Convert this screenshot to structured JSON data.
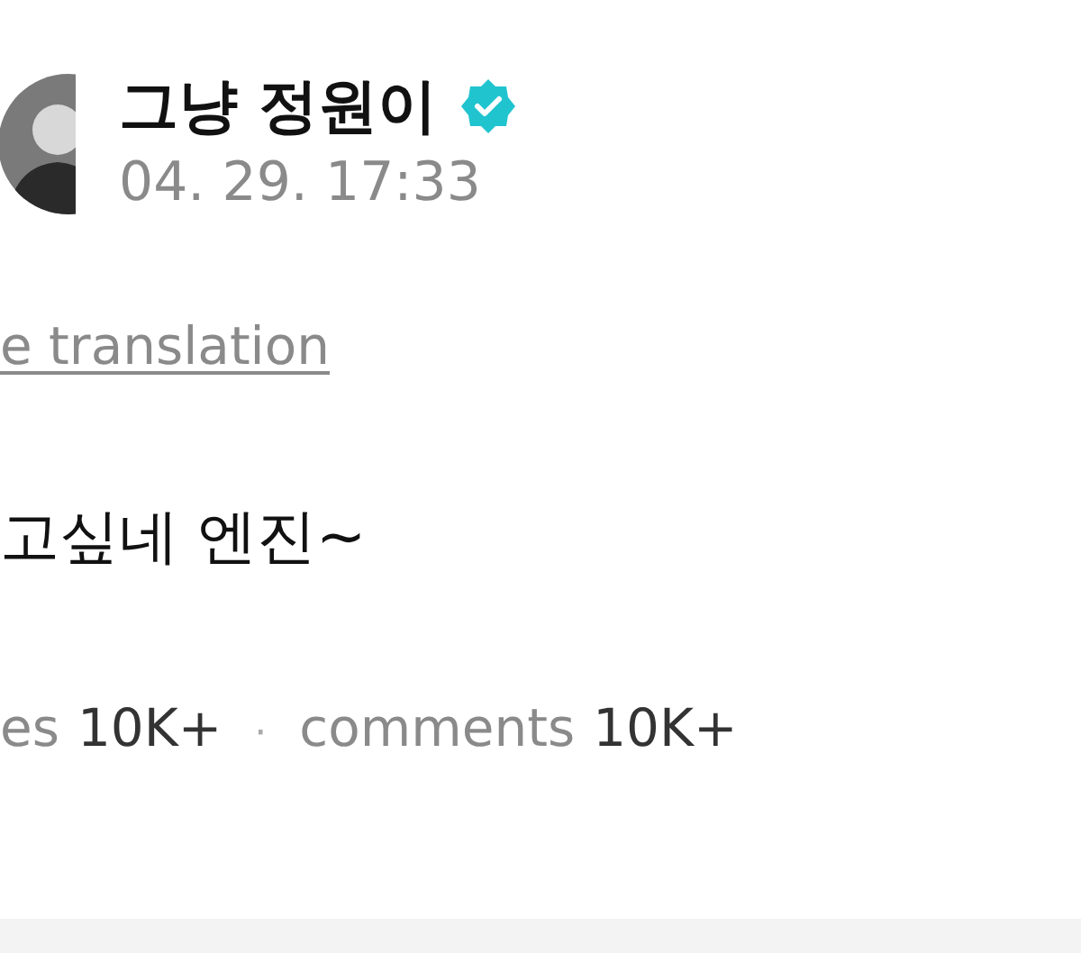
{
  "author": {
    "name": "그냥 정원이",
    "verified": true,
    "timestamp": "04. 29. 17:33"
  },
  "translation_link": "e translation",
  "post_text": "고싶네 엔진~",
  "stats": [
    {
      "label": "es",
      "count": "10K+"
    },
    {
      "label": "comments",
      "count": "10K+"
    }
  ],
  "separator": "·"
}
